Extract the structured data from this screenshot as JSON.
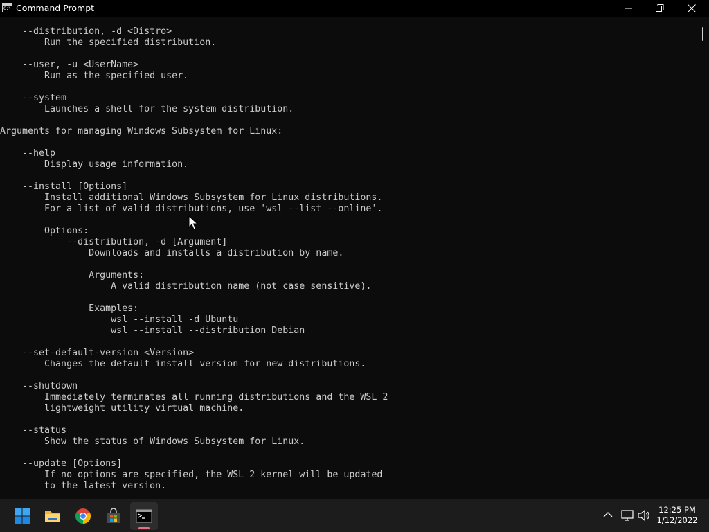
{
  "window": {
    "title": "Command Prompt",
    "icon": "cmd-icon",
    "controls": [
      "minimize-icon",
      "restore-icon",
      "close-icon"
    ]
  },
  "console": {
    "lines": [
      "    --distribution, -d <Distro>",
      "        Run the specified distribution.",
      "",
      "    --user, -u <UserName>",
      "        Run as the specified user.",
      "",
      "    --system",
      "        Launches a shell for the system distribution.",
      "",
      "Arguments for managing Windows Subsystem for Linux:",
      "",
      "    --help",
      "        Display usage information.",
      "",
      "    --install [Options]",
      "        Install additional Windows Subsystem for Linux distributions.",
      "        For a list of valid distributions, use 'wsl --list --online'.",
      "",
      "        Options:",
      "            --distribution, -d [Argument]",
      "                Downloads and installs a distribution by name.",
      "",
      "                Arguments:",
      "                    A valid distribution name (not case sensitive).",
      "",
      "                Examples:",
      "                    wsl --install -d Ubuntu",
      "                    wsl --install --distribution Debian",
      "",
      "    --set-default-version <Version>",
      "        Changes the default install version for new distributions.",
      "",
      "    --shutdown",
      "        Immediately terminates all running distributions and the WSL 2",
      "        lightweight utility virtual machine.",
      "",
      "    --status",
      "        Show the status of Windows Subsystem for Linux.",
      "",
      "    --update [Options]",
      "        If no options are specified, the WSL 2 kernel will be updated",
      "        to the latest version.",
      ""
    ]
  },
  "taskbar": {
    "pinned": [
      {
        "name": "start-icon"
      },
      {
        "name": "file-explorer-icon"
      },
      {
        "name": "chrome-icon"
      },
      {
        "name": "microsoft-store-icon"
      },
      {
        "name": "command-prompt-icon",
        "active": true
      }
    ],
    "tray": [
      "chevron-up-icon",
      "network-icon",
      "volume-icon"
    ],
    "clock": {
      "time": "12:25 PM",
      "date": "1/12/2022"
    }
  },
  "colors": {
    "console_bg": "#0c0c0c",
    "console_text": "#cccccc",
    "titlebar_bg": "#000000",
    "taskbar_bg": "#1c1c1c",
    "active_indicator": "#e0737c"
  }
}
